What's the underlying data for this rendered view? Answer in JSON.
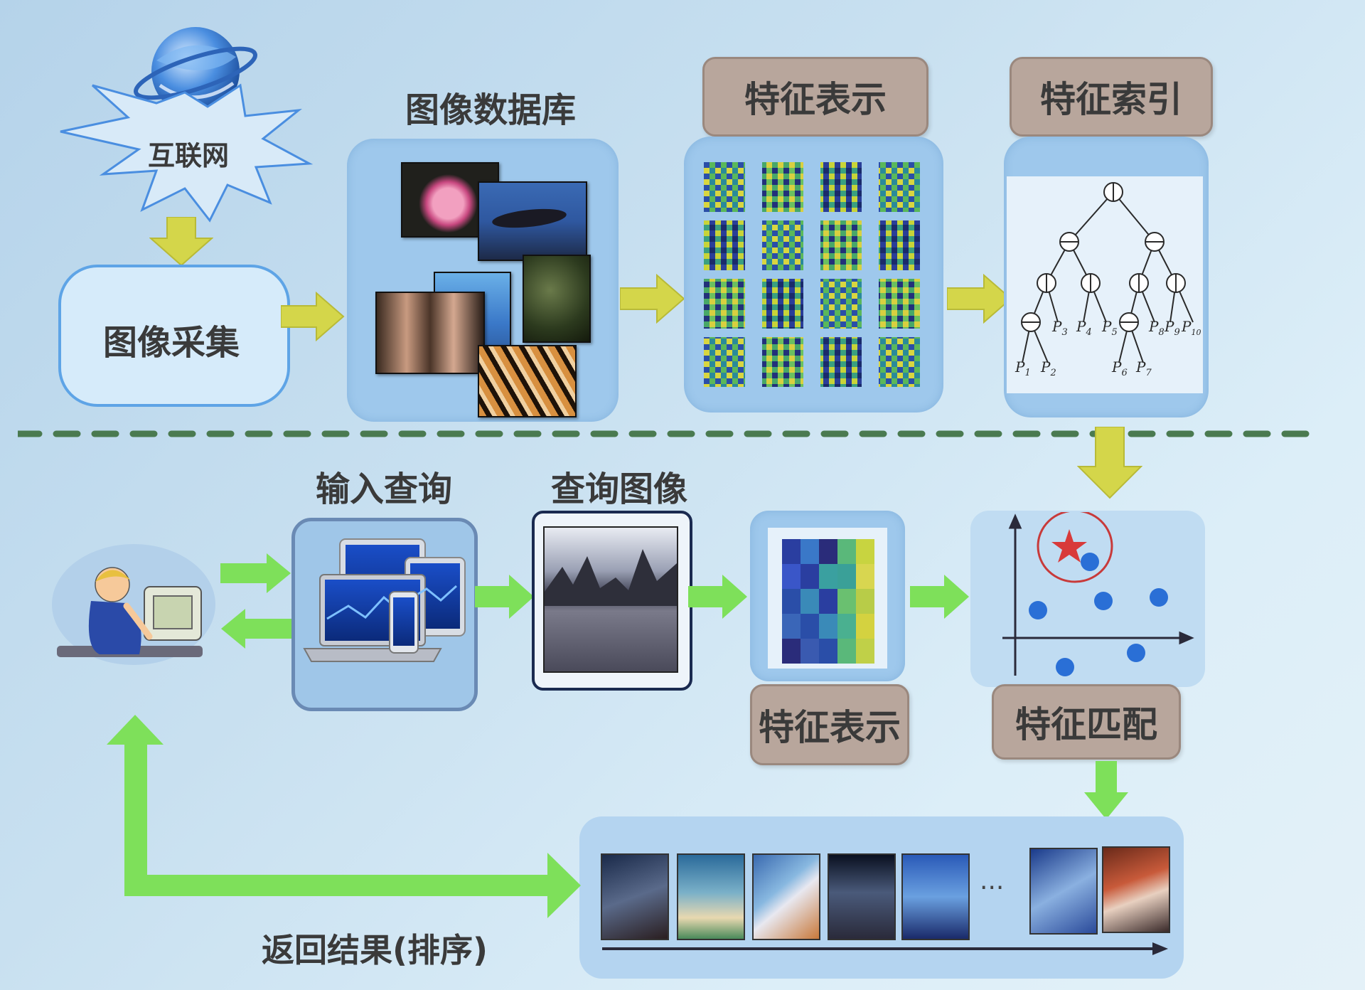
{
  "labels": {
    "internet": "互联网",
    "image_collection": "图像采集",
    "image_database": "图像数据库",
    "feature_representation_top": "特征表示",
    "feature_index": "特征索引",
    "input_query": "输入查询",
    "query_image": "查询图像",
    "feature_representation_bottom": "特征表示",
    "feature_matching": "特征匹配",
    "return_results": "返回结果(排序)",
    "ellipsis": "···"
  },
  "tree_leaves": {
    "p1": "P",
    "p1_sub": "1",
    "p2": "P",
    "p2_sub": "2",
    "p3": "P",
    "p3_sub": "3",
    "p4": "P",
    "p4_sub": "4",
    "p5": "P",
    "p5_sub": "5",
    "p6": "P",
    "p6_sub": "6",
    "p7": "P",
    "p7_sub": "7",
    "p8": "P",
    "p8_sub": "8",
    "p9": "P",
    "p9_sub": "9",
    "p10": "P",
    "p10_sub": "10"
  },
  "colors": {
    "arrow_yellow": "#d4d64a",
    "arrow_green": "#7ee05a",
    "tag_fill": "#b8a69c",
    "panel_fill": "#9ec8ec",
    "dot_blue": "#2a6fd6",
    "star_red": "#d83a3a"
  }
}
